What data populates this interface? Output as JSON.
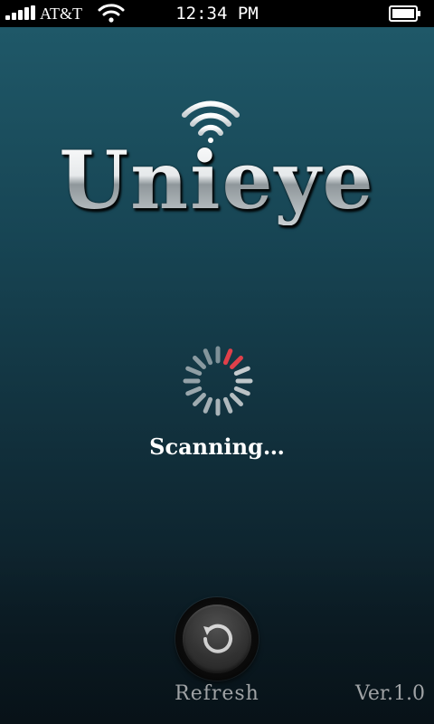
{
  "status_bar": {
    "carrier": "AT&T",
    "time": "12:34 PM",
    "signal_icon": "signal-bars-icon",
    "wifi_icon": "wifi-icon",
    "battery_icon": "battery-full-icon"
  },
  "app": {
    "logo_text": "Unieye",
    "logo_icon": "wifi-icon"
  },
  "scan": {
    "status_text": "Scanning…",
    "spinner_icon": "loading-spinner-icon"
  },
  "footer": {
    "refresh_label": "Refresh",
    "refresh_icon": "refresh-icon",
    "version": "Ver.1.0"
  },
  "colors": {
    "background_top": "#1f5868",
    "background_bottom": "#0a1820",
    "spinner_active": "#e0404a",
    "spinner_idle": "#d6dadc",
    "label": "#c9cdd0"
  }
}
